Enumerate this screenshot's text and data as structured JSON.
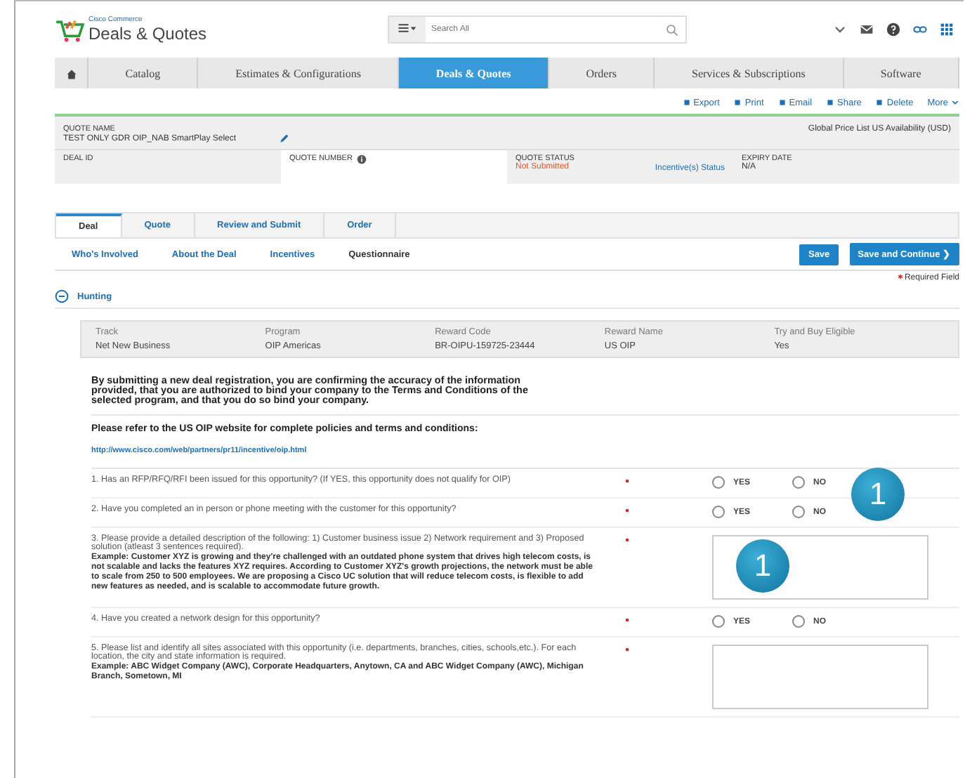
{
  "header": {
    "brand_small": "Cisco Commerce",
    "brand": "Deals & Quotes",
    "search": {
      "placeholder": "Search All"
    }
  },
  "nav": [
    {
      "label": "Catalog",
      "selected": false
    },
    {
      "label": "Estimates & Configurations",
      "selected": false
    },
    {
      "label": "Deals & Quotes",
      "selected": true
    },
    {
      "label": "Orders",
      "selected": false
    },
    {
      "label": "Services & Subscriptions",
      "selected": false
    },
    {
      "label": "Software",
      "selected": false
    }
  ],
  "actions": [
    "Export",
    "Print",
    "Email",
    "Share",
    "Delete",
    "More"
  ],
  "quote": {
    "name_label": "QUOTE NAME",
    "name": "TEST ONLY GDR OIP_NAB SmartPlay Select",
    "price_list": "Global Price List US Availability (USD)",
    "deal_id_label": "DEAL ID",
    "quote_number_label": "QUOTE NUMBER",
    "status_label": "QUOTE STATUS",
    "status": "Not Submitted",
    "incentive_link": "Incentive(s) Status",
    "expiry_label": "EXPIRY DATE",
    "expiry": "N/A"
  },
  "tabs": [
    {
      "label": "Deal",
      "selected": true
    },
    {
      "label": "Quote",
      "selected": false
    },
    {
      "label": "Review and Submit",
      "selected": false
    },
    {
      "label": "Order",
      "selected": false
    }
  ],
  "subtabs": [
    {
      "label": "Who's Involved",
      "selected": false
    },
    {
      "label": "About the Deal",
      "selected": false
    },
    {
      "label": "Incentives",
      "selected": false
    },
    {
      "label": "Questionnaire",
      "selected": true
    }
  ],
  "buttons": [
    "Save",
    "Save and Continue ❯"
  ],
  "required_note": "Required Field",
  "section": {
    "title": "Hunting",
    "expanded": true
  },
  "info": [
    {
      "label": "Track",
      "value": "Net New Business"
    },
    {
      "label": "Program",
      "value": "OIP Americas"
    },
    {
      "label": "Reward Code",
      "value": "BR-OIPU-159725-23444"
    },
    {
      "label": "Reward Name",
      "value": "US OIP"
    },
    {
      "label": "Try and Buy Eligible",
      "value": "Yes"
    }
  ],
  "disclaimer": "By submitting a new deal registration, you are confirming the accuracy of the information provided, that you are authorized to bind your company to the Terms and Conditions of the selected program, and that you do so bind your company.",
  "refer": {
    "text": "Please refer to the US OIP website for complete policies and terms and conditions:",
    "link": "http://www.cisco.com/web/partners/pr11/incentive/oip.html"
  },
  "questions": [
    {
      "kind": "yesno",
      "text": "1. Has an RFP/RFQ/RFI been issued for this opportunity?  (If YES, this opportunity does not qualify for OIP)",
      "options": [
        {
          "label": "YES",
          "selected": false
        },
        {
          "label": "NO",
          "selected": false
        }
      ],
      "callout": "1"
    },
    {
      "kind": "yesno",
      "text": "2. Have you completed an in person or phone meeting with the customer for this opportunity?",
      "options": [
        {
          "label": "YES",
          "selected": false
        },
        {
          "label": "NO",
          "selected": false
        }
      ]
    },
    {
      "kind": "text",
      "text": "3. Please provide a detailed description of the following: 1) Customer business issue 2) Network requirement and 3) Proposed solution (atleast 3 sentences required).",
      "example": "Example: Customer XYZ is growing and they're challenged with an outdated phone system that drives high telecom costs, is not scalable and lacks the features XYZ requires. According to Customer XYZ's growth projections, the network must be able to scale from 250 to 500 employees. We are proposing a Cisco UC solution that will reduce telecom costs, is flexible to add new features as needed, and is scalable to accommodate future growth.",
      "callout": "1"
    },
    {
      "kind": "yesno",
      "text": "4. Have you created a network design for this opportunity?",
      "options": [
        {
          "label": "YES",
          "selected": false
        },
        {
          "label": "NO",
          "selected": false
        }
      ]
    },
    {
      "kind": "text",
      "text": "5. Please list and identify all sites associated with this opportunity (i.e. departments, branches, cities, schools,etc.). For each location, the city and state information is required.",
      "example": "Example: ABC Widget Company (AWC), Corporate Headquarters, Anytown, CA and ABC Widget Company (AWC), Michigan Branch, Sometown, MI"
    }
  ]
}
